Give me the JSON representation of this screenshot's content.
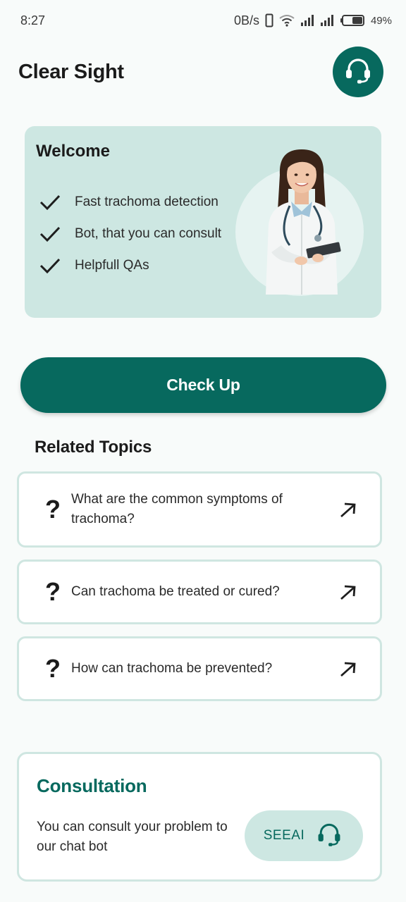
{
  "status_bar": {
    "time": "8:27",
    "network_speed": "0B/s",
    "battery_percent": "49%",
    "icons": [
      "vibrate-icon",
      "wifi-icon",
      "signal-icon",
      "signal-icon",
      "battery-icon"
    ]
  },
  "header": {
    "title": "Clear Sight",
    "support_icon": "headset-icon"
  },
  "welcome": {
    "title": "Welcome",
    "features": [
      {
        "icon": "check-icon",
        "label": "Fast trachoma detection"
      },
      {
        "icon": "check-icon",
        "label": "Bot, that you can consult"
      },
      {
        "icon": "check-icon",
        "label": "Helpfull QAs"
      }
    ]
  },
  "checkup": {
    "label": "Check Up"
  },
  "related": {
    "title": "Related Topics",
    "topics": [
      {
        "icon": "question-icon",
        "symbol": "?",
        "text": "What are the common symptoms of trachoma?",
        "arrow": "arrow-up-right-icon"
      },
      {
        "icon": "question-icon",
        "symbol": "?",
        "text": "Can trachoma be treated or cured?",
        "arrow": "arrow-up-right-icon"
      },
      {
        "icon": "question-icon",
        "symbol": "?",
        "text": "How can trachoma be prevented?",
        "arrow": "arrow-up-right-icon"
      }
    ]
  },
  "consultation": {
    "title": "Consultation",
    "description": "You can consult your problem to our chat bot",
    "button_label": "SEEAI",
    "button_icon": "headset-icon"
  },
  "colors": {
    "primary": "#07695e",
    "card_bg": "#cde7e2",
    "border": "#cfe6e1",
    "background": "#f8fbfa"
  }
}
